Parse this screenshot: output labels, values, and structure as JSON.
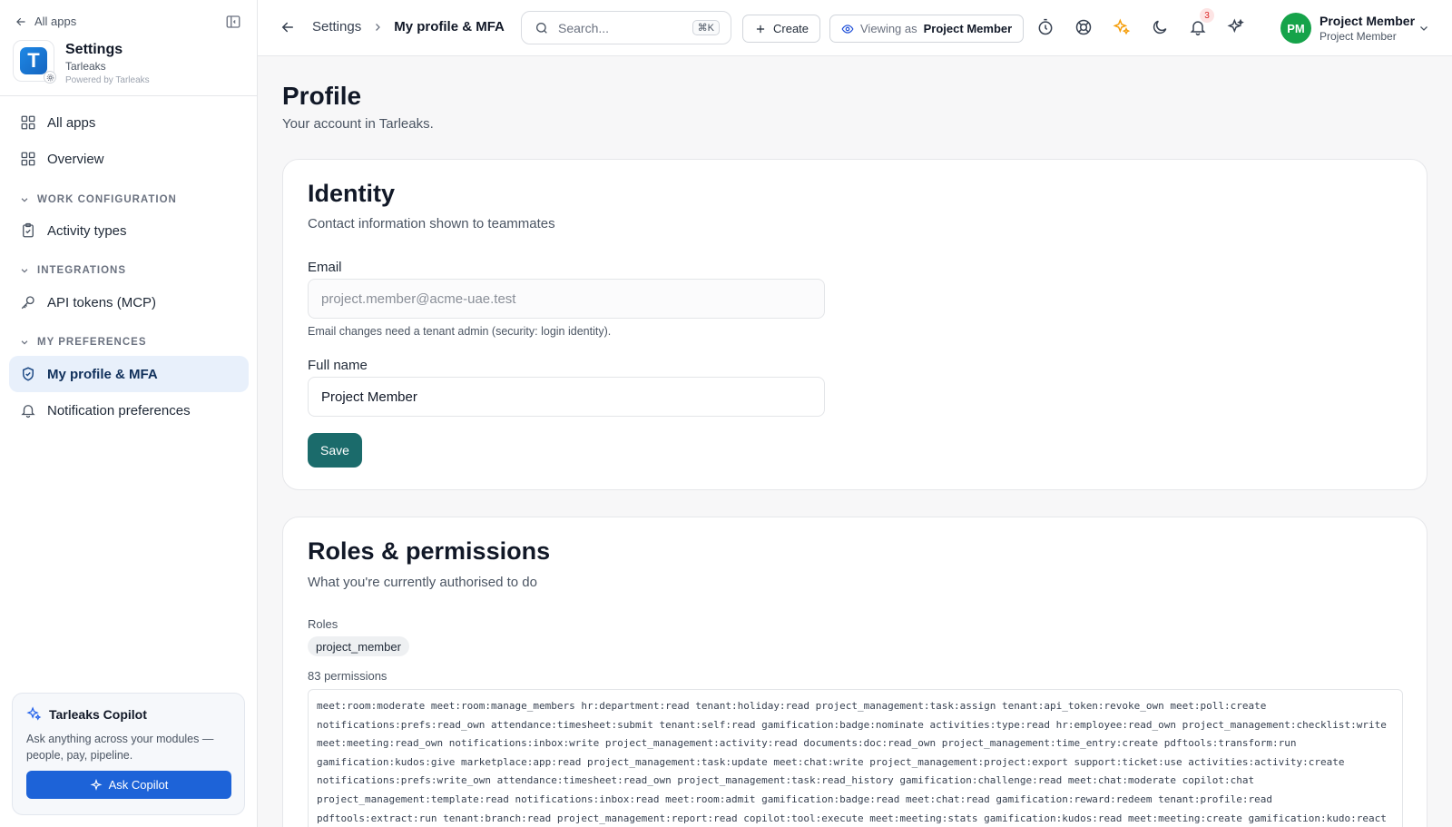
{
  "sidebar": {
    "back_label": "All apps",
    "brand": {
      "letter": "T",
      "title": "Settings",
      "tenant": "Tarleaks",
      "powered": "Powered by Tarleaks"
    },
    "items": [
      {
        "label": "All apps"
      },
      {
        "label": "Overview"
      },
      {
        "label": "Activity types"
      },
      {
        "label": "API tokens (MCP)"
      },
      {
        "label": "My profile & MFA"
      },
      {
        "label": "Notification preferences"
      }
    ],
    "sections": [
      "WORK CONFIGURATION",
      "INTEGRATIONS",
      "MY PREFERENCES"
    ],
    "copilot": {
      "title": "Tarleaks Copilot",
      "description": "Ask anything across your modules — people, pay, pipeline.",
      "button": "Ask Copilot"
    }
  },
  "topbar": {
    "breadcrumb": [
      "Settings",
      "My profile & MFA"
    ],
    "search": {
      "placeholder": "Search...",
      "shortcut": "⌘K"
    },
    "create_label": "Create",
    "viewing_label": "Viewing as",
    "viewing_value": "Project Member",
    "notification_count": "3",
    "user": {
      "initials": "PM",
      "name": "Project Member",
      "role": "Project Member"
    }
  },
  "page": {
    "title": "Profile",
    "subtitle": "Your account in Tarleaks."
  },
  "identity": {
    "title": "Identity",
    "subtitle": "Contact information shown to teammates",
    "email_label": "Email",
    "email_value": "project.member@acme-uae.test",
    "email_hint": "Email changes need a tenant admin (security: login identity).",
    "fullname_label": "Full name",
    "fullname_value": "Project Member",
    "save_label": "Save"
  },
  "roles": {
    "title": "Roles & permissions",
    "subtitle": "What you're currently authorised to do",
    "roles_label": "Roles",
    "role_chip": "project_member",
    "permissions_count": "83 permissions",
    "permissions_text": "meet:room:moderate meet:room:manage_members hr:department:read tenant:holiday:read project_management:task:assign tenant:api_token:revoke_own meet:poll:create notifications:prefs:read_own attendance:timesheet:submit tenant:self:read gamification:badge:nominate activities:type:read hr:employee:read_own project_management:checklist:write meet:meeting:read_own notifications:inbox:write project_management:activity:read documents:doc:read_own project_management:time_entry:create pdftools:transform:run gamification:kudos:give marketplace:app:read project_management:task:update meet:chat:write project_management:project:export support:ticket:use activities:activity:create notifications:prefs:write_own attendance:timesheet:read_own project_management:task:read_history gamification:challenge:read meet:chat:moderate copilot:chat project_management:template:read notifications:inbox:read meet:room:admit gamification:badge:read meet:chat:read gamification:reward:redeem tenant:profile:read pdftools:extract:run tenant:branch:read project_management:report:read copilot:tool:execute meet:meeting:stats gamification:kudos:read meet:meeting:create gamification:kudo:react meet:poll:vote"
  }
}
